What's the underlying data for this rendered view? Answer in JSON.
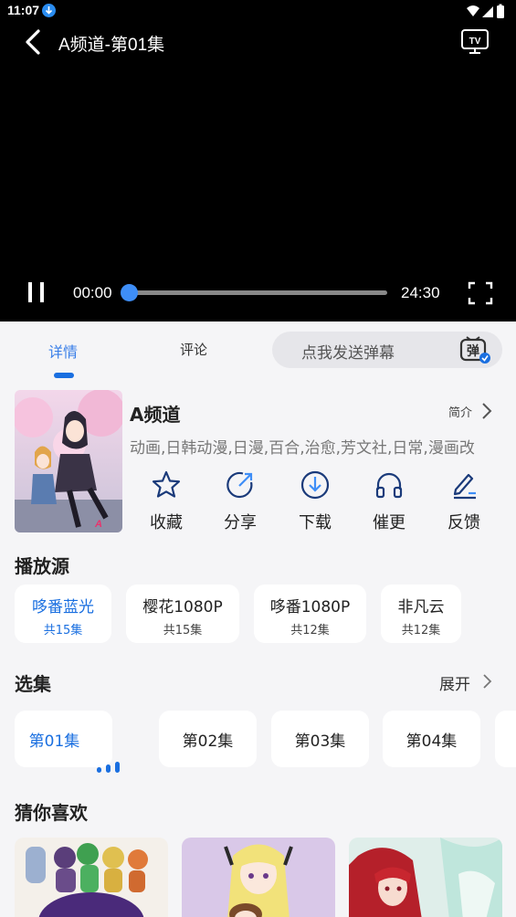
{
  "status_bar": {
    "time": "11:07"
  },
  "player": {
    "title": "A频道-第01集",
    "current_time": "00:00",
    "total_time": "24:30",
    "progress": 0.0,
    "tv_label": "TV"
  },
  "tabs": [
    {
      "label": "详情",
      "active": true
    },
    {
      "label": "评论",
      "active": false
    }
  ],
  "danmaku": {
    "placeholder": "点我发送弹幕",
    "icon_label": "弹"
  },
  "show": {
    "title": "A频道",
    "intro_link": "简介",
    "tags": "动画,日韩动漫,日漫,百合,治愈,芳文社,日常,漫画改"
  },
  "actions": [
    {
      "label": "收藏",
      "icon": "star-icon"
    },
    {
      "label": "分享",
      "icon": "share-icon"
    },
    {
      "label": "下载",
      "icon": "download-icon"
    },
    {
      "label": "催更",
      "icon": "headphones-icon"
    },
    {
      "label": "反馈",
      "icon": "feedback-pen-icon"
    }
  ],
  "sources": {
    "title": "播放源",
    "items": [
      {
        "name": "哆番蓝光",
        "count": "共15集",
        "active": true
      },
      {
        "name": "樱花1080P",
        "count": "共15集",
        "active": false
      },
      {
        "name": "哆番1080P",
        "count": "共12集",
        "active": false
      },
      {
        "name": "非凡云",
        "count": "共12集",
        "active": false
      }
    ]
  },
  "episodes": {
    "title": "选集",
    "expand_label": "展开",
    "items": [
      {
        "label": "第01集",
        "active": true
      },
      {
        "label": "第02集",
        "active": false
      },
      {
        "label": "第03集",
        "active": false
      },
      {
        "label": "第04集",
        "active": false
      }
    ]
  },
  "recommend": {
    "title": "猜你喜欢"
  },
  "colors": {
    "accent": "#1a6fe0",
    "seek": "#3e8ef7",
    "background": "#f5f5f7"
  }
}
